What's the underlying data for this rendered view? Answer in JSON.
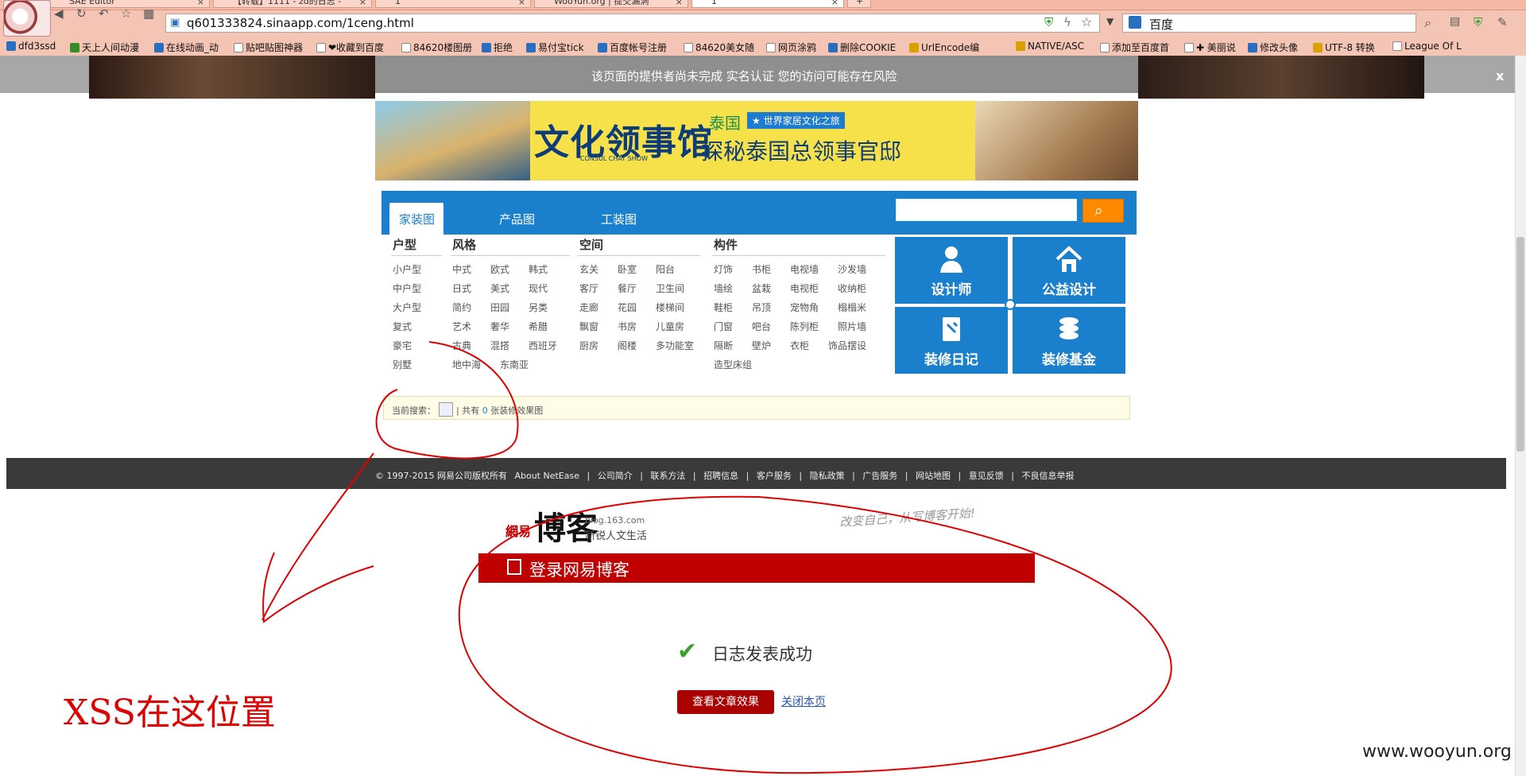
{
  "browser": {
    "tabs": [
      {
        "title": "SAE Editor"
      },
      {
        "title": "【转载】1111 - zd的日志 -"
      },
      {
        "title": "1"
      },
      {
        "title": "WooYun.org | 提交漏洞"
      },
      {
        "title": "1"
      }
    ],
    "new_tab_label": "+",
    "url": "q601333824.sinaapp.com/1ceng.html",
    "search_engine": "百度"
  },
  "bookmarks": [
    "dfd3ssd",
    "天上人间动漫",
    "在线动画_动",
    "贴吧贴图神器",
    "❤收藏到百度",
    "84620楼图册",
    "拒绝",
    "易付宝tick",
    "百度帐号注册",
    "84620美女随",
    "网页涂鸦",
    "删除COOKIE",
    "UrlEncode编",
    "NATIVE/ASC",
    "添加至百度首",
    "✚ 美丽说",
    "修改头像",
    "UTF-8 转换",
    "League Of L"
  ],
  "warning": {
    "text": "该页面的提供者尚未完成  实名认证  您的访问可能存在风险",
    "close_label": "x"
  },
  "banner": {
    "title": "文化领事馆",
    "small": "CONSUL CHAT SHOW",
    "country": "泰国",
    "tag": "★ 世界家居文化之旅",
    "subtitle": "探秘泰国总领事官邸"
  },
  "menu": {
    "tabs": [
      "家装图",
      "产品图",
      "工装图"
    ],
    "search_icon": "search-icon"
  },
  "categories": {
    "huxing": {
      "label": "户型",
      "items": [
        "小户型",
        "中户型",
        "大户型",
        "复式",
        "豪宅",
        "别墅"
      ]
    },
    "fengge": {
      "label": "风格",
      "items": [
        "中式",
        "欧式",
        "韩式",
        "日式",
        "美式",
        "现代",
        "简约",
        "田园",
        "另类",
        "艺术",
        "奢华",
        "希腊",
        "古典",
        "混搭",
        "西班牙",
        "地中海",
        "东南亚"
      ]
    },
    "kongjian": {
      "label": "空间",
      "items": [
        "玄关",
        "卧室",
        "阳台",
        "客厅",
        "餐厅",
        "卫生间",
        "走廊",
        "花园",
        "楼梯间",
        "飘窗",
        "书房",
        "儿童房",
        "厨房",
        "阁楼",
        "多功能室"
      ]
    },
    "goujian": {
      "label": "构件",
      "items": [
        "灯饰",
        "书柜",
        "电视墙",
        "沙发墙",
        "墙绘",
        "盆栽",
        "电视柜",
        "收纳柜",
        "鞋柜",
        "吊顶",
        "宠物角",
        "榻榻米",
        "门窗",
        "吧台",
        "陈列柜",
        "照片墙",
        "隔断",
        "壁炉",
        "衣柜",
        "饰品摆设",
        "造型床组"
      ]
    }
  },
  "tiles": [
    "设计师",
    "公益设计",
    "装修日记",
    "装修基金"
  ],
  "current_search": {
    "label": "当前搜索：",
    "sep": "|",
    "prefix": "共有",
    "count": "0",
    "suffix": "张装修效果图"
  },
  "footer": {
    "links": [
      "© 1997-2015 网易公司版权所有",
      "About NetEase",
      "|",
      "公司简介",
      "|",
      "联系方法",
      "|",
      "招聘信息",
      "|",
      "客户服务",
      "|",
      "隐私政策",
      "|",
      "广告服务",
      "|",
      "网站地图",
      "|",
      "意见反馈",
      "|",
      "不良信息举报"
    ]
  },
  "blog": {
    "logo_red": "網易",
    "logo": "博客",
    "url": "blog.163.com",
    "slogan": "新锐人文生活",
    "handwriting": "改变自己，从写博客开始!",
    "header": "登录网易博客",
    "success": "日志发表成功",
    "view_button": "查看文章效果",
    "close_link": "关闭本页"
  },
  "annotation": {
    "note": "XSS在这位置",
    "color": "#e00000"
  },
  "watermark": "www.wooyun.org"
}
